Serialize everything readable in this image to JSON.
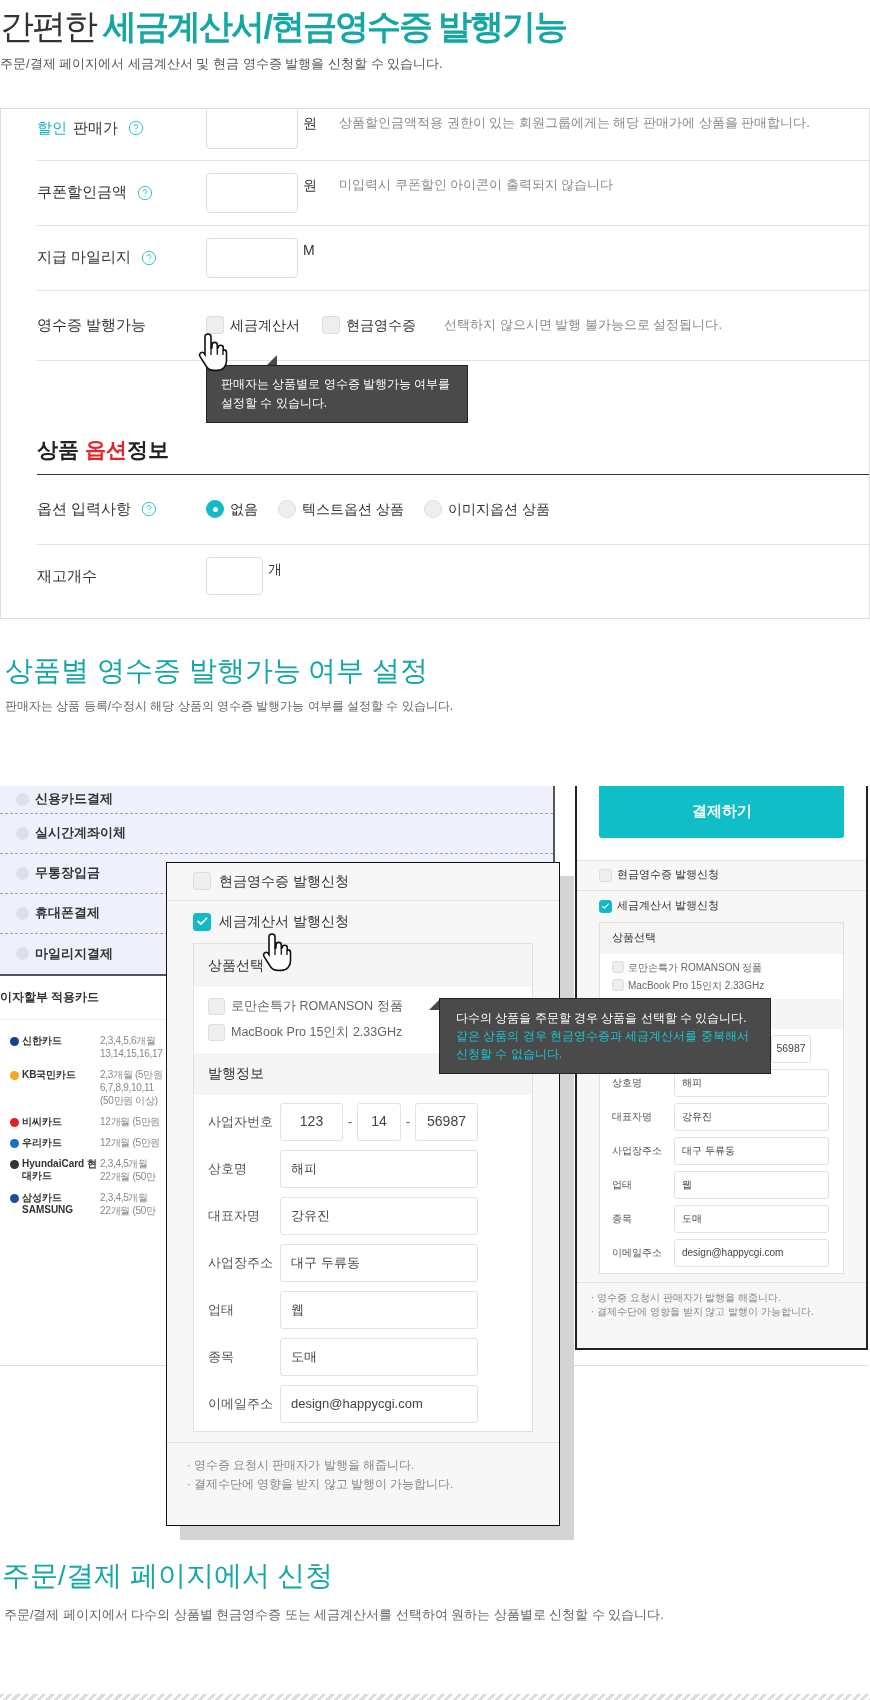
{
  "header": {
    "title_prefix": "간편한",
    "title_highlight": "세금계산서/현금영수증 발행기능",
    "subtitle": "주문/결제 페이지에서 세금계산서 및 현금 영수증 발행을 신청할 수 있습니다."
  },
  "product_form": {
    "rows": [
      {
        "kind": "input",
        "label_highlight": "할인",
        "label": "판매가",
        "help": true,
        "unit": "원",
        "hint": "상품할인금액적용 권한이 있는 회원그룹에게는 해당 판매가에 상품을 판매합니다."
      },
      {
        "kind": "input",
        "label": "쿠폰할인금액",
        "help": true,
        "unit": "원",
        "hint": "미입력시 쿠폰할인 아이콘이 출력되지 않습니다"
      },
      {
        "kind": "input",
        "label": "지급 마일리지",
        "help": true,
        "unit": "M"
      },
      {
        "kind": "checks",
        "label": "영수증 발행가능",
        "help": false,
        "options": [
          {
            "label": "세금계산서",
            "checked": false
          },
          {
            "label": "현금영수증",
            "checked": false
          }
        ],
        "hint": "선택하지 않으시면 발행 불가능으로 설정됩니다.",
        "tooltip": "판매자는 상품별로 영수증 발행가능 여부를 설정할 수 있습니다."
      }
    ],
    "option_heading": {
      "before": "상품",
      "highlight": "옵션",
      "after": "정보"
    },
    "option_rows": [
      {
        "kind": "radios",
        "label": "옵션 입력사항",
        "help": true,
        "options": [
          {
            "label": "없음",
            "selected": true
          },
          {
            "label": "텍스트옵션 상품",
            "selected": false
          },
          {
            "label": "이미지옵션 상품",
            "selected": false
          }
        ]
      },
      {
        "kind": "input",
        "label": "재고개수",
        "help": false,
        "unit": "개"
      }
    ]
  },
  "section_setting": {
    "title": "상품별 영수증 발행가능 여부 설정",
    "subtitle": "판매자는 상품 등록/수정시 해당 상품의 영수증 발행가능 여부를 설정할 수 있습니다."
  },
  "demo": {
    "payment_methods": [
      {
        "label": "신용카드결제",
        "selected": false
      },
      {
        "label": "실시간계좌이체",
        "selected": false
      },
      {
        "label": "무통장입금",
        "selected": false
      },
      {
        "label": "휴대폰결제",
        "selected": false
      },
      {
        "label": "마일리지결제",
        "selected": false
      }
    ],
    "card_list": {
      "title": "이자할부 적용카드",
      "cards": [
        {
          "name": "신한카드",
          "color": "#1d3f8f",
          "lines": [
            "2,3,4,5,6개월",
            "13,14,15,16,17"
          ]
        },
        {
          "name": "KB국민카드",
          "color": "#f5a623",
          "lines": [
            "2,3개월 (5만원",
            "6,7,8,9,10,11",
            "(50만원 이상)"
          ]
        },
        {
          "name": "비씨카드",
          "color": "#e0202a",
          "lines": [
            "12개월 (5만원"
          ]
        },
        {
          "name": "우리카드",
          "color": "#1a6ec0",
          "lines": [
            "12개월 (5만원"
          ]
        },
        {
          "name": "HyundaiCard 현대카드",
          "color": "#333333",
          "lines": [
            "2,3,4,5개월",
            "22개월 (50만"
          ]
        },
        {
          "name": "삼성카드 SAMSUNG",
          "color": "#1c4fa0",
          "lines": [
            "2,3,4,5개월",
            "22개월 (50만"
          ]
        }
      ]
    },
    "popup": {
      "checks": [
        {
          "label": "현금영수증 발행신청",
          "checked": false
        },
        {
          "label": "세금계산서 발행신청",
          "checked": true
        }
      ],
      "product_heading": "상품선택",
      "products": [
        {
          "label": "로만손특가 ROMANSON 정품",
          "checked": false
        },
        {
          "label": "MacBook Pro 15인치 2.33GHz",
          "checked": false
        }
      ],
      "issue_heading": "발행정보",
      "business_number": {
        "label": "사업자번호",
        "parts": [
          "123",
          "14",
          "56987"
        ],
        "separators": [
          "-",
          "-"
        ]
      },
      "fields": [
        {
          "label": "상호명",
          "value": "해피"
        },
        {
          "label": "대표자명",
          "value": "강유진"
        },
        {
          "label": "사업장주소",
          "value": "대구 두류동"
        },
        {
          "label": "업태",
          "value": "웹"
        },
        {
          "label": "종목",
          "value": "도매"
        },
        {
          "label": "이메일주소",
          "value": "design@happycgi.com"
        }
      ],
      "notes": [
        "· 영수증 요청시 판매자가 발행을 해줍니다.",
        "· 결제수단에 영향을 받지 않고 발행이 가능합니다."
      ]
    },
    "tooltip": {
      "line": "다수의 상품을 주문할 경우 상품을 선택할 수 있습니다.",
      "highlight": "같은 상품의 경우 현금영수증과 세금계산서를 중복해서 신청할 수 없습니다."
    },
    "side_panel": {
      "pay_button": "결제하기",
      "checks": [
        {
          "label": "현금영수증 발행신청",
          "checked": false
        },
        {
          "label": "세금계산서 발행신청",
          "checked": true
        }
      ],
      "product_heading": "상품선택",
      "products": [
        {
          "label": "로만손특가 ROMANSON 정품",
          "checked": false
        },
        {
          "label": "MacBook Pro 15인치 2.33GHz",
          "checked": false
        }
      ],
      "business_number_tail": "56987",
      "fields": [
        {
          "label": "상호명",
          "value": "해피"
        },
        {
          "label": "대표자명",
          "value": "강유진"
        },
        {
          "label": "사업장주소",
          "value": "대구 두류동"
        },
        {
          "label": "업태",
          "value": "웹"
        },
        {
          "label": "종목",
          "value": "도매"
        },
        {
          "label": "이메일주소",
          "value": "design@happycgi.com"
        }
      ],
      "notes": [
        "· 영수증 요청시 판매자가 발행을 해줍니다.",
        "· 결제수단에 영향을 받지 않고 발행이 가능합니다."
      ]
    }
  },
  "section_order": {
    "title": "주문/결제 페이지에서 신청",
    "subtitle": "주문/결제 페이지에서 다수의 상품별 현금영수증 또는 세금계산서를 선택하여 원하는 상품별로 신청할 수 있습니다."
  }
}
